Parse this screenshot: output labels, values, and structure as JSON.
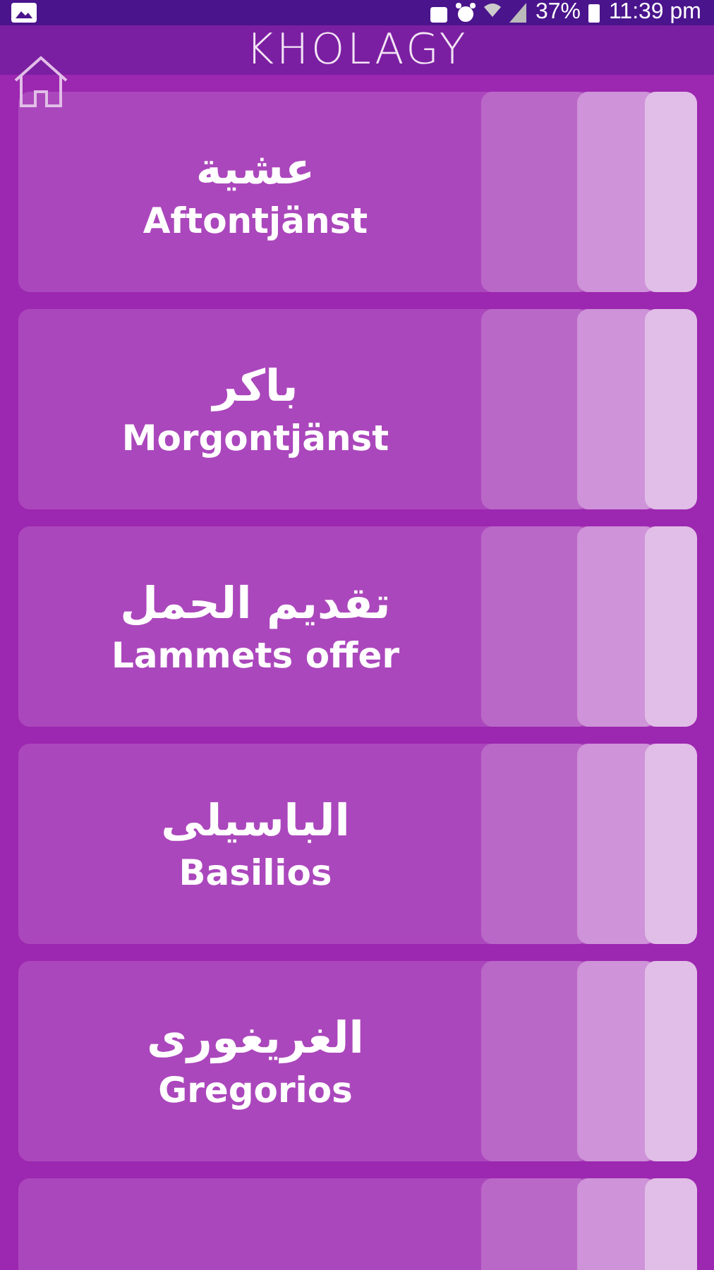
{
  "status_bar": {
    "battery": "37%",
    "time": "11:39 pm"
  },
  "app_bar": {
    "title": "KHOLAGY"
  },
  "items": [
    {
      "arabic": "عشية",
      "title": "Aftontjänst"
    },
    {
      "arabic": "باكر",
      "title": "Morgontjänst"
    },
    {
      "arabic": "تقديم الحمل",
      "title": "Lammets offer"
    },
    {
      "arabic": "الباسيلى",
      "title": "Basilios"
    },
    {
      "arabic": "الغريغورى",
      "title": "Gregorios"
    }
  ]
}
